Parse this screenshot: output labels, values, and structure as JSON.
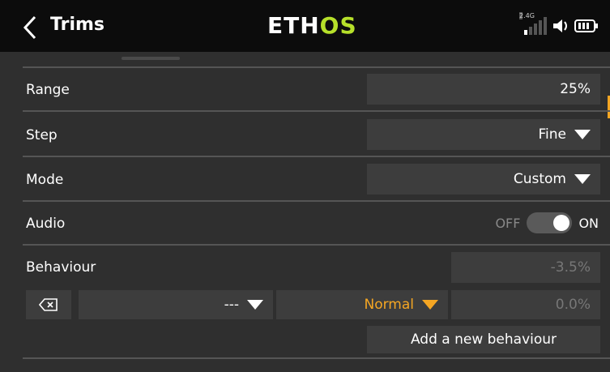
{
  "header": {
    "title": "Trims",
    "logo_main": "ETH",
    "logo_accent": "OS",
    "signal_band": "2.4G"
  },
  "rows": {
    "range": {
      "label": "Range",
      "value": "25%"
    },
    "step": {
      "label": "Step",
      "value": "Fine"
    },
    "mode": {
      "label": "Mode",
      "value": "Custom"
    },
    "audio": {
      "label": "Audio",
      "off_label": "OFF",
      "on_label": "ON",
      "state": "on"
    },
    "behaviour": {
      "label": "Behaviour",
      "value": "-3.5%",
      "source_value": "---",
      "type_value": "Normal",
      "amount_value": "0.0%",
      "add_label": "Add a new behaviour"
    }
  },
  "colors": {
    "accent": "#b6e02a",
    "highlight": "#f5a623",
    "field_bg": "#3d3d3d",
    "background": "#2f2f2f",
    "header_bg": "#0c0c0c"
  }
}
